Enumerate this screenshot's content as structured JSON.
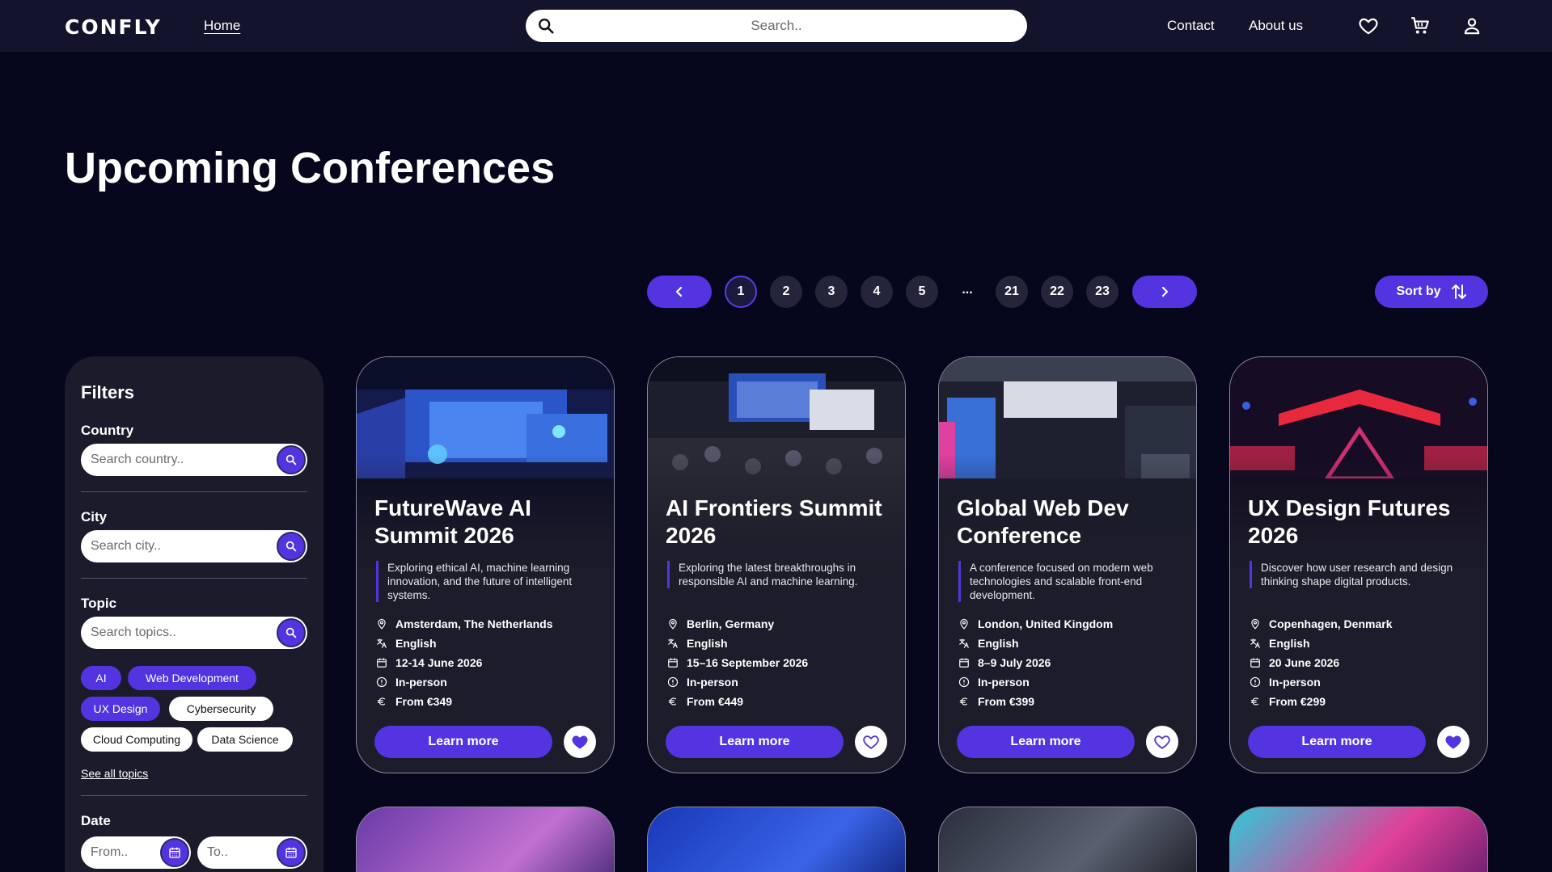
{
  "nav": {
    "logo": "CONFLY",
    "home": "Home",
    "search_placeholder": "Search..",
    "contact": "Contact",
    "about": "About us"
  },
  "page_title": "Upcoming Conferences",
  "pagination": {
    "pages": [
      "1",
      "2",
      "3",
      "4",
      "5",
      "...",
      "21",
      "22",
      "23"
    ],
    "current": "1",
    "sort_label": "Sort by"
  },
  "filters": {
    "title": "Filters",
    "country_label": "Country",
    "country_placeholder": "Search country..",
    "city_label": "City",
    "city_placeholder": "Search city..",
    "topic_label": "Topic",
    "topic_placeholder": "Search topics..",
    "topics": [
      {
        "label": "AI",
        "selected": true
      },
      {
        "label": "Web Development",
        "selected": true
      },
      {
        "label": "UX Design",
        "selected": true
      },
      {
        "label": "Cybersecurity",
        "selected": false
      },
      {
        "label": "Cloud Computing",
        "selected": false
      },
      {
        "label": "Data Science",
        "selected": false
      }
    ],
    "see_all": "See all topics",
    "date_label": "Date",
    "date_from_placeholder": "From..",
    "date_to_placeholder": "To.."
  },
  "cards": [
    {
      "title": "FutureWave AI Summit 2026",
      "description": "Exploring ethical AI, machine learning innovation, and the future of intelligent systems.",
      "location": "Amsterdam, The Netherlands",
      "language": "English",
      "date": "12-14 June 2026",
      "format": "In-person",
      "price": "From €349",
      "button": "Learn more",
      "favorited": true
    },
    {
      "title": "AI Frontiers Summit 2026",
      "description": "Exploring the latest breakthroughs in responsible AI and machine learning.",
      "location": "Berlin, Germany",
      "language": "English",
      "date": "15–16 September 2026",
      "format": "In-person",
      "price": "From €449",
      "button": "Learn more",
      "favorited": false
    },
    {
      "title": "Global Web Dev Conference",
      "description": "A conference focused on modern web technologies and scalable front-end development.",
      "location": "London, United Kingdom",
      "language": "English",
      "date": "8–9 July 2026",
      "format": "In-person",
      "price": "From €399",
      "button": "Learn more",
      "favorited": false
    },
    {
      "title": "UX Design Futures 2026",
      "description": "Discover how user research and design thinking shape digital products.",
      "location": "Copenhagen, Denmark",
      "language": "English",
      "date": "20 June 2026",
      "format": "In-person",
      "price": "From €299",
      "button": "Learn more",
      "favorited": true
    }
  ],
  "colors": {
    "background": "#06061c",
    "nav": "#13132b",
    "accent": "#5434e0",
    "card": "#1c1c2a"
  }
}
